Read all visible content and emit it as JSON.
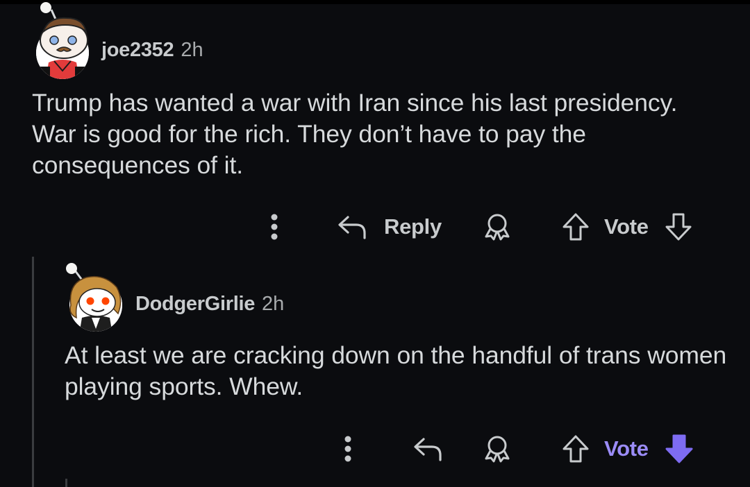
{
  "comments": [
    {
      "username": "joe2352",
      "time": "2h",
      "body": "Trump has wanted a war with Iran since his last presidency. War is good for the rich. They don’t have to pay the consequences of it.",
      "actions": {
        "reply": "Reply",
        "vote": "Vote"
      },
      "avatar_icon": "snoo-avatar-mustache"
    },
    {
      "username": "DodgerGirlie",
      "time": "2h",
      "body": "At least we are cracking down on the handful of trans women playing sports. Whew.",
      "actions": {
        "vote": "Vote"
      },
      "avatar_icon": "snoo-avatar-curly-hair",
      "downvote_active": true
    }
  ],
  "colors": {
    "background": "#0b0c0f",
    "text": "#d7dadc",
    "downvote_active": "#7e6cf2",
    "vote_active_label": "#9b8cf7"
  },
  "icons": [
    "overflow-menu-icon",
    "reply-arrow-icon",
    "award-icon",
    "upvote-icon",
    "downvote-icon"
  ]
}
